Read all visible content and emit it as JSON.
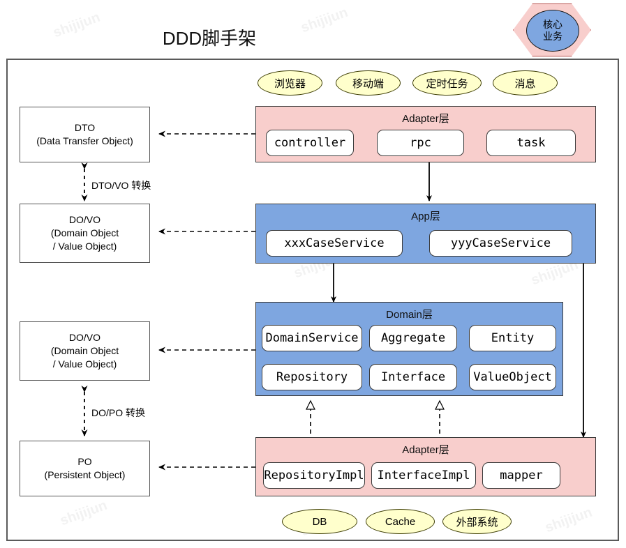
{
  "title": "DDD脚手架",
  "watermark": "shijijun",
  "badge": {
    "line1": "核心",
    "line2": "业务"
  },
  "top_sources": [
    {
      "label": "浏览器"
    },
    {
      "label": "移动端"
    },
    {
      "label": "定时任务"
    },
    {
      "label": "消息"
    }
  ],
  "bottom_sources": [
    {
      "label": "DB"
    },
    {
      "label": "Cache"
    },
    {
      "label": "外部系统"
    }
  ],
  "left_objects": [
    {
      "name": "DTO",
      "line1": "DTO",
      "line2": "(Data Transfer Object)",
      "line3": ""
    },
    {
      "name": "DO/VO upper",
      "line1": "DO/VO",
      "line2": "(Domain Object",
      "line3": "/ Value Object)"
    },
    {
      "name": "DO/VO lower",
      "line1": "DO/VO",
      "line2": "(Domain Object",
      "line3": "/ Value Object)"
    },
    {
      "name": "PO",
      "line1": "PO",
      "line2": "(Persistent Object)",
      "line3": ""
    }
  ],
  "conversions": [
    {
      "label": "DTO/VO 转换"
    },
    {
      "label": "DO/PO 转换"
    }
  ],
  "layers": [
    {
      "id": "adapter-top",
      "title": "Adapter层",
      "color": "#f8cecc",
      "chips": [
        "controller",
        "rpc",
        "task"
      ]
    },
    {
      "id": "app",
      "title": "App层",
      "color": "#7ea6e0",
      "chips": [
        "xxxCaseService",
        "yyyCaseService"
      ]
    },
    {
      "id": "domain",
      "title": "Domain层",
      "color": "#7ea6e0",
      "chips": [
        "DomainService",
        "Aggregate",
        "Entity",
        "Repository",
        "Interface",
        "ValueObject"
      ]
    },
    {
      "id": "adapter-bottom",
      "title": "Adapter层",
      "color": "#f8cecc",
      "chips": [
        "RepositoryImpl",
        "InterfaceImpl",
        "mapper"
      ]
    }
  ],
  "colors": {
    "pink_fill": "#f8cecc",
    "pink_border": "#b85450",
    "blue_fill": "#7ea6e0",
    "yellow_fill": "#ffffcc",
    "frame_border": "#5a5a5a"
  }
}
